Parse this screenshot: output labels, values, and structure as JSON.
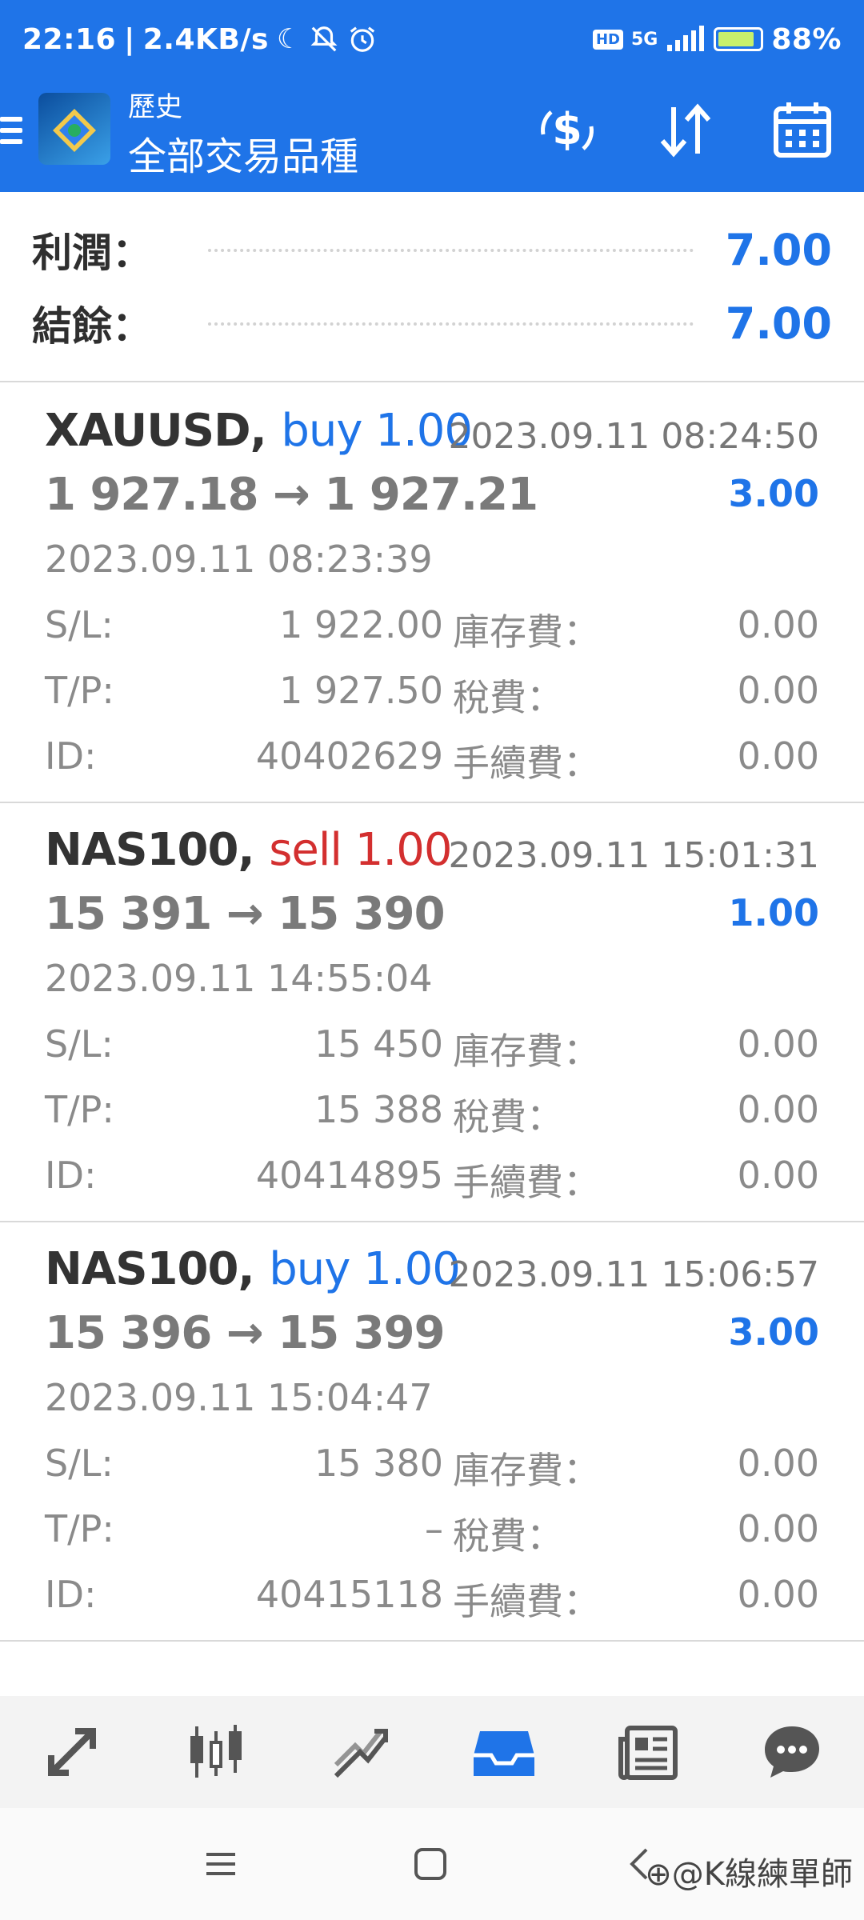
{
  "status_bar": {
    "time": "22:16",
    "network_speed": "2.4KB/s",
    "network_badge": "HD",
    "signal_type": "5G",
    "battery_percent": "88%",
    "battery_level": 0.88,
    "icons": [
      "moon-icon",
      "bell-off-icon",
      "alarm-icon",
      "hd-icon",
      "signal-icon",
      "battery-icon"
    ]
  },
  "app_bar": {
    "subtitle": "歷史",
    "title": "全部交易品種",
    "actions": [
      "dollar-refresh-icon",
      "sort-icon",
      "calendar-icon"
    ]
  },
  "summary": {
    "profit_label": "利潤：",
    "profit_value": "7.00",
    "balance_label": "結餘：",
    "balance_value": "7.00"
  },
  "labels": {
    "sl": "S/L:",
    "tp": "T/P:",
    "id": "ID:",
    "swap": "庫存費：",
    "taxes": "稅費：",
    "commission": "手續費："
  },
  "trades": [
    {
      "symbol": "XAUUSD,",
      "side": "buy 1.00",
      "close_time": "2023.09.11 08:24:50",
      "prices": "1 927.18 → 1 927.21",
      "profit": "3.00",
      "open_time": "2023.09.11 08:23:39",
      "sl": "1 922.00",
      "tp": "1 927.50",
      "id": "40402629",
      "swap": "0.00",
      "taxes": "0.00",
      "commission": "0.00"
    },
    {
      "symbol": "NAS100,",
      "side": "sell 1.00",
      "close_time": "2023.09.11 15:01:31",
      "prices": "15 391 → 15 390",
      "profit": "1.00",
      "open_time": "2023.09.11 14:55:04",
      "sl": "15 450",
      "tp": "15 388",
      "id": "40414895",
      "swap": "0.00",
      "taxes": "0.00",
      "commission": "0.00"
    },
    {
      "symbol": "NAS100,",
      "side": "buy 1.00",
      "close_time": "2023.09.11 15:06:57",
      "prices": "15 396 → 15 399",
      "profit": "3.00",
      "open_time": "2023.09.11 15:04:47",
      "sl": "15 380",
      "tp": "–",
      "id": "40415118",
      "swap": "0.00",
      "taxes": "0.00",
      "commission": "0.00"
    }
  ],
  "bottom_nav": {
    "items": [
      "quotes-icon",
      "chart-icon",
      "trade-icon",
      "history-icon",
      "news-icon",
      "chat-icon"
    ],
    "active": "history-icon"
  },
  "watermark": "⊕@K線練單師",
  "colors": {
    "primary": "#1f74e8",
    "sell": "#d32f2f",
    "text_dark": "#333333",
    "text_muted": "#8a8a8a"
  }
}
